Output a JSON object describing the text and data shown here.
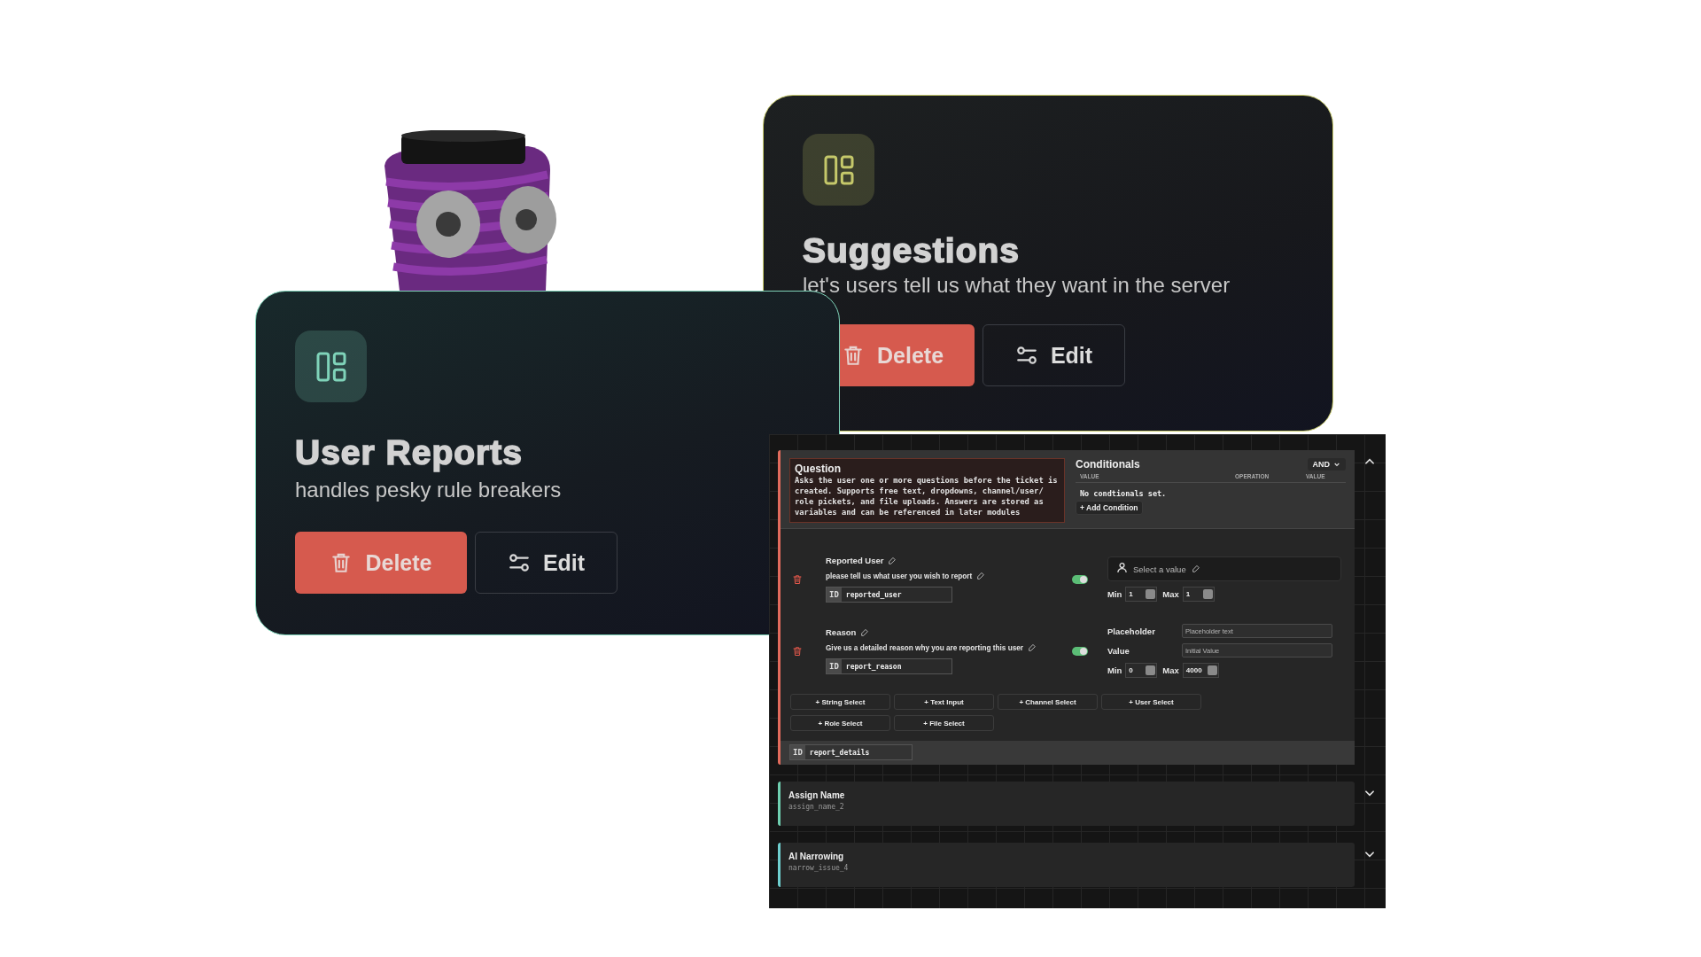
{
  "cards": [
    {
      "title": "Suggestions",
      "description": "let's users tell us what they want in the server",
      "color": "#c5c86a",
      "buttons": [
        {
          "kind": "delete",
          "label": "Delete"
        },
        {
          "kind": "edit",
          "label": "Edit"
        }
      ]
    },
    {
      "title": "User Reports",
      "description": "handles pesky rule breakers",
      "color": "#7fd3b9",
      "buttons": [
        {
          "kind": "delete",
          "label": "Delete"
        },
        {
          "kind": "edit",
          "label": "Edit"
        }
      ]
    }
  ],
  "editor": {
    "question": {
      "title": "Question",
      "description": "Asks the user one or more questions before the ticket is created. Supports free text, dropdowns, channel/user/ role pickets, and file uploads. Answers are stored as variables and can be referenced in later modules",
      "color": "#e26b5c",
      "expanded": true,
      "conditionals": {
        "title": "Conditionals",
        "logic": "AND",
        "columns": [
          "VALUE",
          "OPERATION",
          "VALUE"
        ],
        "empty_text": "No condtionals set.",
        "add_button": "+ Add Condition"
      },
      "fields": [
        {
          "kind": "user_select",
          "label": "Reported User",
          "prompt": "please tell us what user you wish to report",
          "on": true,
          "id_label": "ID",
          "id": "reported_user",
          "placeholder": "Select a value",
          "min_label": "Min",
          "min": "1",
          "max_label": "Max",
          "max": "1"
        },
        {
          "kind": "text_input",
          "label": "Reason",
          "prompt": "Give us a detailed reason why you are reporting this user",
          "on": true,
          "id_label": "ID",
          "id": "report_reason",
          "placeholder_label": "Placeholder",
          "placeholder": "Placeholder text",
          "value_label": "Value",
          "value_placeholder": "Initial Value",
          "min_label": "Min",
          "min": "0",
          "max_label": "Max",
          "max": "4000"
        }
      ],
      "add_buttons": [
        "+ String Select",
        "+ Text Input",
        "+ Channel Select",
        "+ User Select",
        "+ Role Select",
        "+ File Select"
      ],
      "id_label": "ID",
      "id": "report_details"
    },
    "modules": [
      {
        "title": "Assign Name",
        "id": "assign_name_2",
        "color": "#6fcfb0",
        "expanded": false
      },
      {
        "title": "AI Narrowing",
        "id": "narrow_issue_4",
        "color": "#6fcfcf",
        "expanded": false
      }
    ]
  }
}
